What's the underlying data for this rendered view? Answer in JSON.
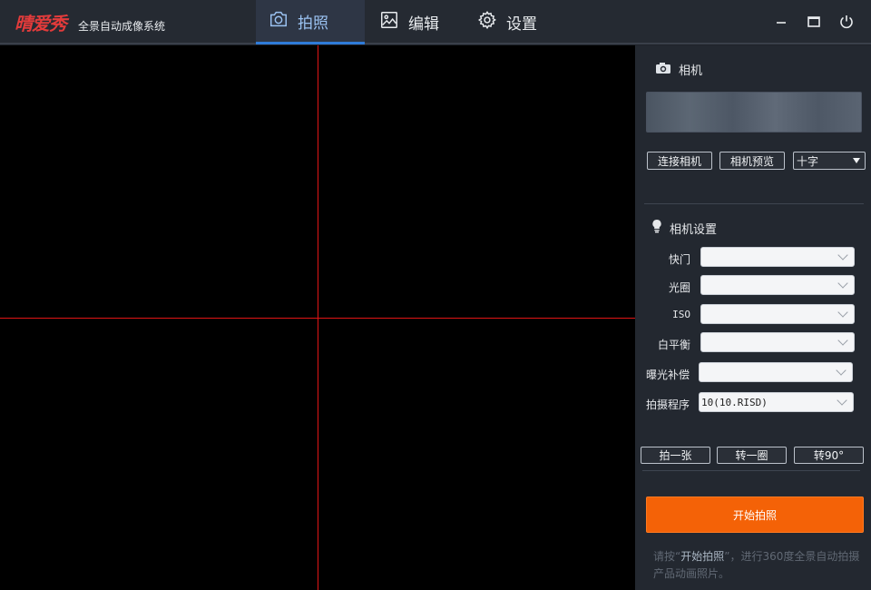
{
  "app": {
    "logo": "晴爱秀",
    "subtitle": "全景自动成像系统"
  },
  "tabs": [
    {
      "label": "拍照",
      "icon": "camera-icon",
      "active": true
    },
    {
      "label": "编辑",
      "icon": "image-icon",
      "active": false
    },
    {
      "label": "设置",
      "icon": "gear-icon",
      "active": false
    }
  ],
  "window_controls": [
    "minimize-icon",
    "maximize-icon",
    "power-icon"
  ],
  "canvas": {
    "crosshair_color": "#e01515",
    "background": "#000000"
  },
  "camera_section": {
    "title": "相机",
    "connect_label": "连接相机",
    "preview_label": "相机预览",
    "overlay_select_value": "十字"
  },
  "settings_section": {
    "title": "相机设置",
    "fields": [
      {
        "label": "快门",
        "value": ""
      },
      {
        "label": "光圈",
        "value": ""
      },
      {
        "label": "ISO",
        "value": ""
      },
      {
        "label": "白平衡",
        "value": ""
      },
      {
        "label": "曝光补偿",
        "value": ""
      },
      {
        "label": "拍摄程序",
        "value": "10(10.RISD)"
      }
    ]
  },
  "actions": {
    "shoot_one": "拍一张",
    "rotate_circle": "转一圈",
    "rotate_90": "转90°",
    "start": "开始拍照"
  },
  "hint": {
    "prefix": "请按“",
    "highlight": "开始拍照",
    "suffix": "”，进行360度全景自动拍摄产品动画照片。"
  },
  "colors": {
    "accent_blue": "#2f7bd8",
    "start_orange": "#f46207",
    "panel_bg": "#232830",
    "titlebar_bg": "#252a32"
  }
}
